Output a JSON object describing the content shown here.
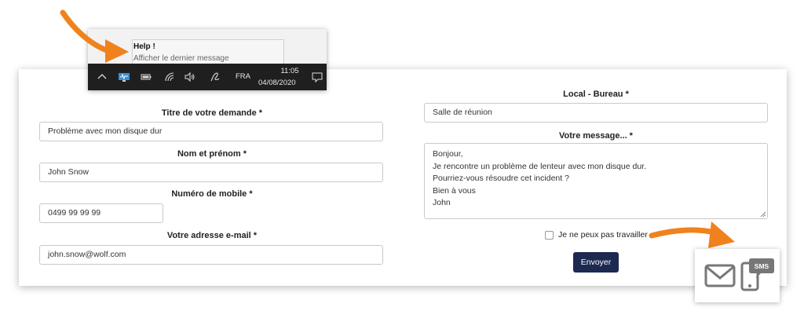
{
  "tray": {
    "tip_title": "Help !",
    "tip_body": "Afficher le dernier message",
    "language": "FRA",
    "time": "11:05",
    "date": "04/08/2020",
    "icons": [
      "chevron-up-icon",
      "monitor-app-icon",
      "battery-icon",
      "wifi-icon",
      "speaker-icon",
      "pen-icon",
      "notification-icon"
    ]
  },
  "form": {
    "title_label": "Titre de votre demande *",
    "title_value": "Problème avec mon disque dur",
    "name_label": "Nom et prénom *",
    "name_value": "John Snow",
    "mobile_label": "Numéro de mobile *",
    "mobile_value": "0499 99 99 99",
    "email_label": "Votre adresse e-mail *",
    "email_value": "john.snow@wolf.com",
    "office_label": "Local - Bureau *",
    "office_value": "Salle de réunion",
    "message_label": "Votre message... *",
    "message_lines": [
      "Bonjour,",
      "Je rencontre un problème de lenteur avec mon disque dur.",
      "Pourriez-vous résoudre cet incident ?",
      "Bien à vous",
      "John"
    ],
    "cannot_work_label": "Je ne peux pas travailler",
    "submit_label": "Envoyer"
  },
  "contact": {
    "icons": [
      "mail-icon",
      "sms-phone-icon"
    ],
    "sms_label": "SMS"
  },
  "colors": {
    "accent_orange": "#f0821e",
    "button_navy": "#1d2951",
    "taskbar": "#1f1f1f"
  }
}
